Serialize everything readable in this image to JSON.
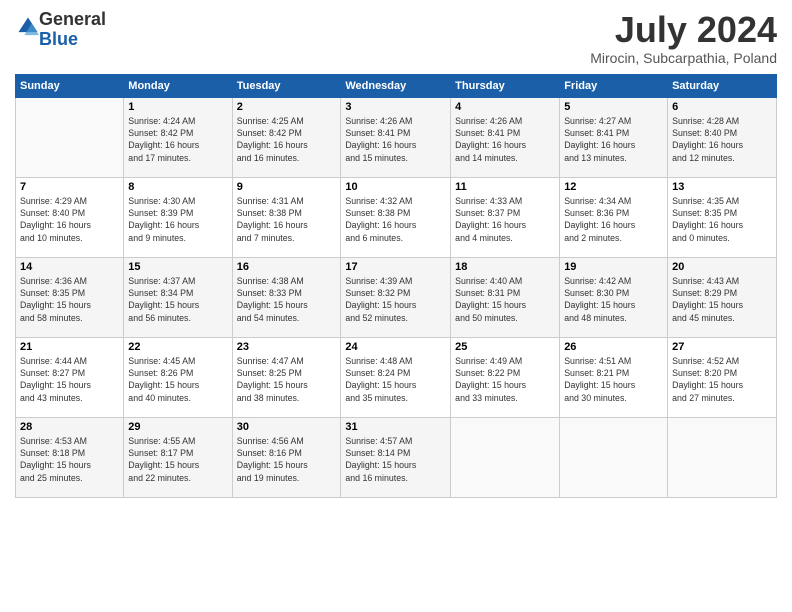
{
  "header": {
    "logo_general": "General",
    "logo_blue": "Blue",
    "month_year": "July 2024",
    "location": "Mirocin, Subcarpathia, Poland"
  },
  "columns": [
    "Sunday",
    "Monday",
    "Tuesday",
    "Wednesday",
    "Thursday",
    "Friday",
    "Saturday"
  ],
  "weeks": [
    [
      {
        "day": "",
        "info": ""
      },
      {
        "day": "1",
        "info": "Sunrise: 4:24 AM\nSunset: 8:42 PM\nDaylight: 16 hours\nand 17 minutes."
      },
      {
        "day": "2",
        "info": "Sunrise: 4:25 AM\nSunset: 8:42 PM\nDaylight: 16 hours\nand 16 minutes."
      },
      {
        "day": "3",
        "info": "Sunrise: 4:26 AM\nSunset: 8:41 PM\nDaylight: 16 hours\nand 15 minutes."
      },
      {
        "day": "4",
        "info": "Sunrise: 4:26 AM\nSunset: 8:41 PM\nDaylight: 16 hours\nand 14 minutes."
      },
      {
        "day": "5",
        "info": "Sunrise: 4:27 AM\nSunset: 8:41 PM\nDaylight: 16 hours\nand 13 minutes."
      },
      {
        "day": "6",
        "info": "Sunrise: 4:28 AM\nSunset: 8:40 PM\nDaylight: 16 hours\nand 12 minutes."
      }
    ],
    [
      {
        "day": "7",
        "info": "Sunrise: 4:29 AM\nSunset: 8:40 PM\nDaylight: 16 hours\nand 10 minutes."
      },
      {
        "day": "8",
        "info": "Sunrise: 4:30 AM\nSunset: 8:39 PM\nDaylight: 16 hours\nand 9 minutes."
      },
      {
        "day": "9",
        "info": "Sunrise: 4:31 AM\nSunset: 8:38 PM\nDaylight: 16 hours\nand 7 minutes."
      },
      {
        "day": "10",
        "info": "Sunrise: 4:32 AM\nSunset: 8:38 PM\nDaylight: 16 hours\nand 6 minutes."
      },
      {
        "day": "11",
        "info": "Sunrise: 4:33 AM\nSunset: 8:37 PM\nDaylight: 16 hours\nand 4 minutes."
      },
      {
        "day": "12",
        "info": "Sunrise: 4:34 AM\nSunset: 8:36 PM\nDaylight: 16 hours\nand 2 minutes."
      },
      {
        "day": "13",
        "info": "Sunrise: 4:35 AM\nSunset: 8:35 PM\nDaylight: 16 hours\nand 0 minutes."
      }
    ],
    [
      {
        "day": "14",
        "info": "Sunrise: 4:36 AM\nSunset: 8:35 PM\nDaylight: 15 hours\nand 58 minutes."
      },
      {
        "day": "15",
        "info": "Sunrise: 4:37 AM\nSunset: 8:34 PM\nDaylight: 15 hours\nand 56 minutes."
      },
      {
        "day": "16",
        "info": "Sunrise: 4:38 AM\nSunset: 8:33 PM\nDaylight: 15 hours\nand 54 minutes."
      },
      {
        "day": "17",
        "info": "Sunrise: 4:39 AM\nSunset: 8:32 PM\nDaylight: 15 hours\nand 52 minutes."
      },
      {
        "day": "18",
        "info": "Sunrise: 4:40 AM\nSunset: 8:31 PM\nDaylight: 15 hours\nand 50 minutes."
      },
      {
        "day": "19",
        "info": "Sunrise: 4:42 AM\nSunset: 8:30 PM\nDaylight: 15 hours\nand 48 minutes."
      },
      {
        "day": "20",
        "info": "Sunrise: 4:43 AM\nSunset: 8:29 PM\nDaylight: 15 hours\nand 45 minutes."
      }
    ],
    [
      {
        "day": "21",
        "info": "Sunrise: 4:44 AM\nSunset: 8:27 PM\nDaylight: 15 hours\nand 43 minutes."
      },
      {
        "day": "22",
        "info": "Sunrise: 4:45 AM\nSunset: 8:26 PM\nDaylight: 15 hours\nand 40 minutes."
      },
      {
        "day": "23",
        "info": "Sunrise: 4:47 AM\nSunset: 8:25 PM\nDaylight: 15 hours\nand 38 minutes."
      },
      {
        "day": "24",
        "info": "Sunrise: 4:48 AM\nSunset: 8:24 PM\nDaylight: 15 hours\nand 35 minutes."
      },
      {
        "day": "25",
        "info": "Sunrise: 4:49 AM\nSunset: 8:22 PM\nDaylight: 15 hours\nand 33 minutes."
      },
      {
        "day": "26",
        "info": "Sunrise: 4:51 AM\nSunset: 8:21 PM\nDaylight: 15 hours\nand 30 minutes."
      },
      {
        "day": "27",
        "info": "Sunrise: 4:52 AM\nSunset: 8:20 PM\nDaylight: 15 hours\nand 27 minutes."
      }
    ],
    [
      {
        "day": "28",
        "info": "Sunrise: 4:53 AM\nSunset: 8:18 PM\nDaylight: 15 hours\nand 25 minutes."
      },
      {
        "day": "29",
        "info": "Sunrise: 4:55 AM\nSunset: 8:17 PM\nDaylight: 15 hours\nand 22 minutes."
      },
      {
        "day": "30",
        "info": "Sunrise: 4:56 AM\nSunset: 8:16 PM\nDaylight: 15 hours\nand 19 minutes."
      },
      {
        "day": "31",
        "info": "Sunrise: 4:57 AM\nSunset: 8:14 PM\nDaylight: 15 hours\nand 16 minutes."
      },
      {
        "day": "",
        "info": ""
      },
      {
        "day": "",
        "info": ""
      },
      {
        "day": "",
        "info": ""
      }
    ]
  ]
}
